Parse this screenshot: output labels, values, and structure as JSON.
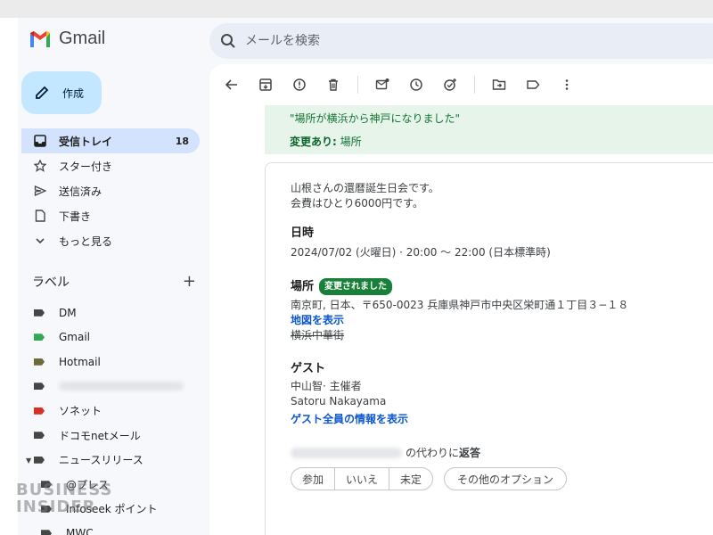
{
  "app": {
    "name": "Gmail"
  },
  "search": {
    "placeholder": "メールを検索"
  },
  "compose": {
    "label": "作成"
  },
  "nav": [
    {
      "label": "受信トレイ",
      "count": "18",
      "icon": "inbox-icon"
    },
    {
      "label": "スター付き",
      "icon": "star-icon"
    },
    {
      "label": "送信済み",
      "icon": "send-icon"
    },
    {
      "label": "下書き",
      "icon": "draft-icon"
    },
    {
      "label": "もっと見る",
      "icon": "chevron-down-icon"
    }
  ],
  "labels_section": {
    "title": "ラベル",
    "add": "+"
  },
  "labels": [
    {
      "label": "DM",
      "color": "#444746"
    },
    {
      "label": "Gmail",
      "color": "#34a853"
    },
    {
      "label": "Hotmail",
      "color": "#6d6b3c"
    },
    {
      "label": "",
      "color": "#444746",
      "blurred": true
    },
    {
      "label": "ソネット",
      "color": "#d93025"
    },
    {
      "label": "ドコモnetメール",
      "color": "#444746"
    },
    {
      "label": "ニュースリリース",
      "color": "#444746"
    },
    {
      "label": "@プレス",
      "color": "#444746"
    },
    {
      "label": "Infoseek ポイント",
      "color": "#444746"
    },
    {
      "label": "MWC",
      "color": "#444746"
    }
  ],
  "toolbar": {
    "icons": [
      "back-arrow-icon",
      "archive-icon",
      "report-spam-icon",
      "delete-icon",
      "mark-unread-icon",
      "snooze-icon",
      "add-task-icon",
      "move-to-icon",
      "label-icon",
      "more-icon"
    ]
  },
  "banner": {
    "quote": "\"場所が横浜から神戸になりました\"",
    "change_label": "変更あり:",
    "change_value": " 場所"
  },
  "event": {
    "desc_line1": "山根さんの還暦誕生日会です。",
    "desc_line2": "会費はひとり6000円です。",
    "date_heading": "日時",
    "date_value": "2024/07/02 (火曜日) · 20:00 ～ 22:00 (日本標準時)",
    "place_heading": "場所",
    "place_badge": "変更されました",
    "address": "南京町, 日本、〒650-0023 兵庫県神戸市中央区栄町通１丁目３−１８",
    "map_link": "地図を表示",
    "old_place": "横浜中華街",
    "guests_heading": "ゲスト",
    "guest1": "中山智· 主催者",
    "guest2": "Satoru Nakayama",
    "guests_link": "ゲスト全員の情報を表示",
    "reply_suffix": "の代わりに",
    "reply_bold": "返答",
    "rsvp": {
      "yes": "参加",
      "no": "いいえ",
      "maybe": "未定"
    },
    "other_options": "その他のオプション"
  },
  "watermark": {
    "line1": "BUSINESS",
    "line2": "INSIDER"
  },
  "colors": {
    "accent": "#0b57d0",
    "compose_bg": "#c2e7ff",
    "active_nav": "#d3e3fd",
    "banner_bg": "#e6f4ea",
    "badge": "#188038"
  }
}
